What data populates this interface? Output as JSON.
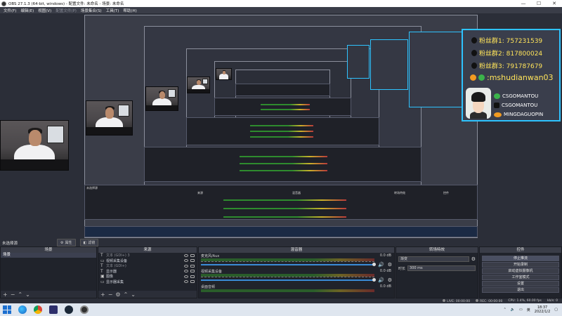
{
  "window": {
    "title": "OBS 27.1.3 (64-bit, windows) - 配置文件: 未命名 - 场景: 未命名",
    "controls": [
      "—",
      "☐",
      "✕"
    ]
  },
  "menu": [
    "文件(F)",
    "编辑(E)",
    "视图(V)",
    "配置文件(P)",
    "场景集合(S)",
    "工具(T)",
    "帮助(H)"
  ],
  "preview": {
    "info_card": {
      "fans1": "粉丝群1:  757231539",
      "fans2": "粉丝群2:  817800024",
      "fans3": "粉丝群3:  791787679",
      "douyu": ":mshudianwan03",
      "wechat": "CSGOMANTOU",
      "tiktok": "CSGOMANTOU",
      "weibo": "MINGDAGUOPIN"
    },
    "inner_labels": {
      "scene_label": "未选择源",
      "scenes_title": "场景",
      "sources_title": "来源",
      "mixer_title": "混音器",
      "transition_title": "转场特效",
      "controls_title": "控件"
    }
  },
  "scene_header": {
    "label": "未选择源",
    "properties": "属性",
    "filters": "滤镜"
  },
  "docks": {
    "scenes": {
      "title": "场景",
      "items": [
        "场景"
      ]
    },
    "sources": {
      "title": "来源",
      "items": [
        {
          "type": "T",
          "name": "文本 (GDI+) 3"
        },
        {
          "type": "▭",
          "name": "视频采集设备"
        },
        {
          "type": "T",
          "name": "文本 (GDI+)"
        },
        {
          "type": "T",
          "name": "显示器"
        },
        {
          "type": "▣",
          "name": "图像"
        },
        {
          "type": "▭",
          "name": "显示器采集"
        }
      ]
    },
    "mixer": {
      "title": "混音器",
      "channels": [
        {
          "name": "麦克风/Aux",
          "db": "0.0 dB"
        },
        {
          "name": "视频采集设备",
          "db": "0.0 dB"
        },
        {
          "name": "桌面音频",
          "db": "0.0 dB"
        }
      ]
    },
    "transitions": {
      "title": "转场特效",
      "type": "渐变",
      "duration_label": "时长",
      "duration_value": "300 ms"
    },
    "controls": {
      "title": "控件",
      "buttons": [
        "停止推流",
        "开始录制",
        "启动虚拟摄像机",
        "工作室模式",
        "设置",
        "退出"
      ]
    }
  },
  "status": {
    "live": "LIVE: 00:00:00",
    "rec": "REC: 00:00:00",
    "cpu": "CPU: 1.4%, 60.00 fps",
    "dropped": "kb/s: 0"
  },
  "taskbar": {
    "time": "18:37",
    "date": "2022/1/2",
    "lang": "英"
  }
}
